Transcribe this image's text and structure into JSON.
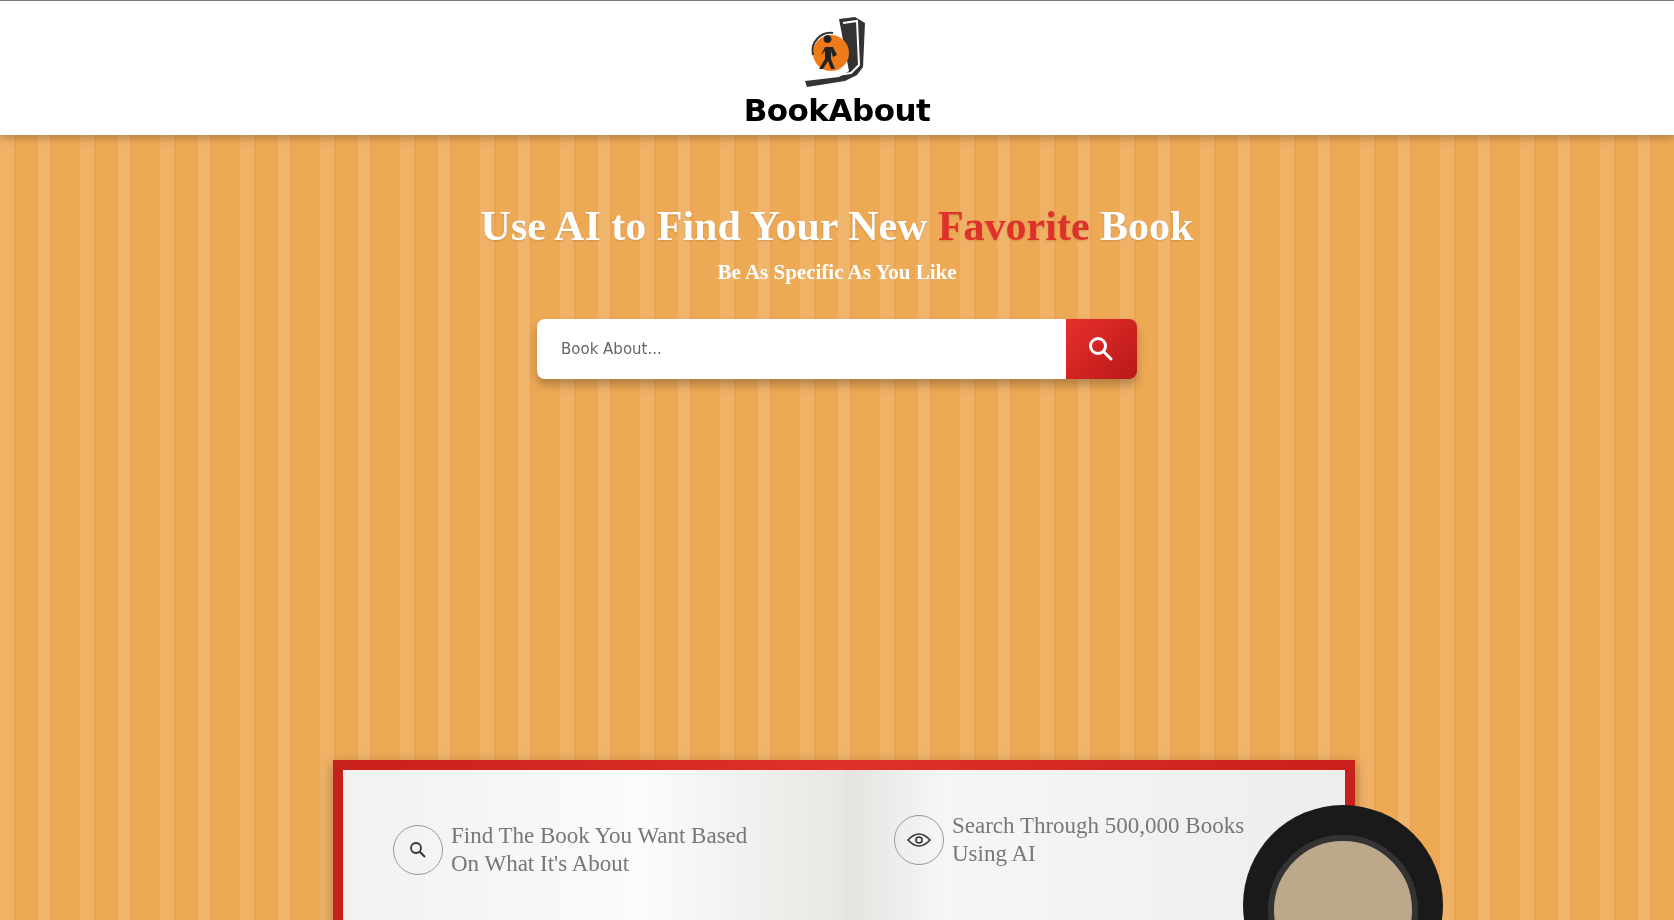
{
  "header": {
    "brand": "BookAbout"
  },
  "hero": {
    "title_parts": [
      {
        "text": "Use AI to Find Your New ",
        "highlight": false
      },
      {
        "text": "Favorite",
        "highlight": true
      },
      {
        "text": " Book",
        "highlight": false
      }
    ],
    "subtitle": "Be As Specific As You Like",
    "search": {
      "placeholder": "Book About..."
    }
  },
  "book": {
    "features": [
      {
        "kind": "search",
        "text": "Find The Book You Want Based On What It's About"
      },
      {
        "kind": "view",
        "text": "Search Through 500,000 Books Using AI"
      }
    ]
  }
}
